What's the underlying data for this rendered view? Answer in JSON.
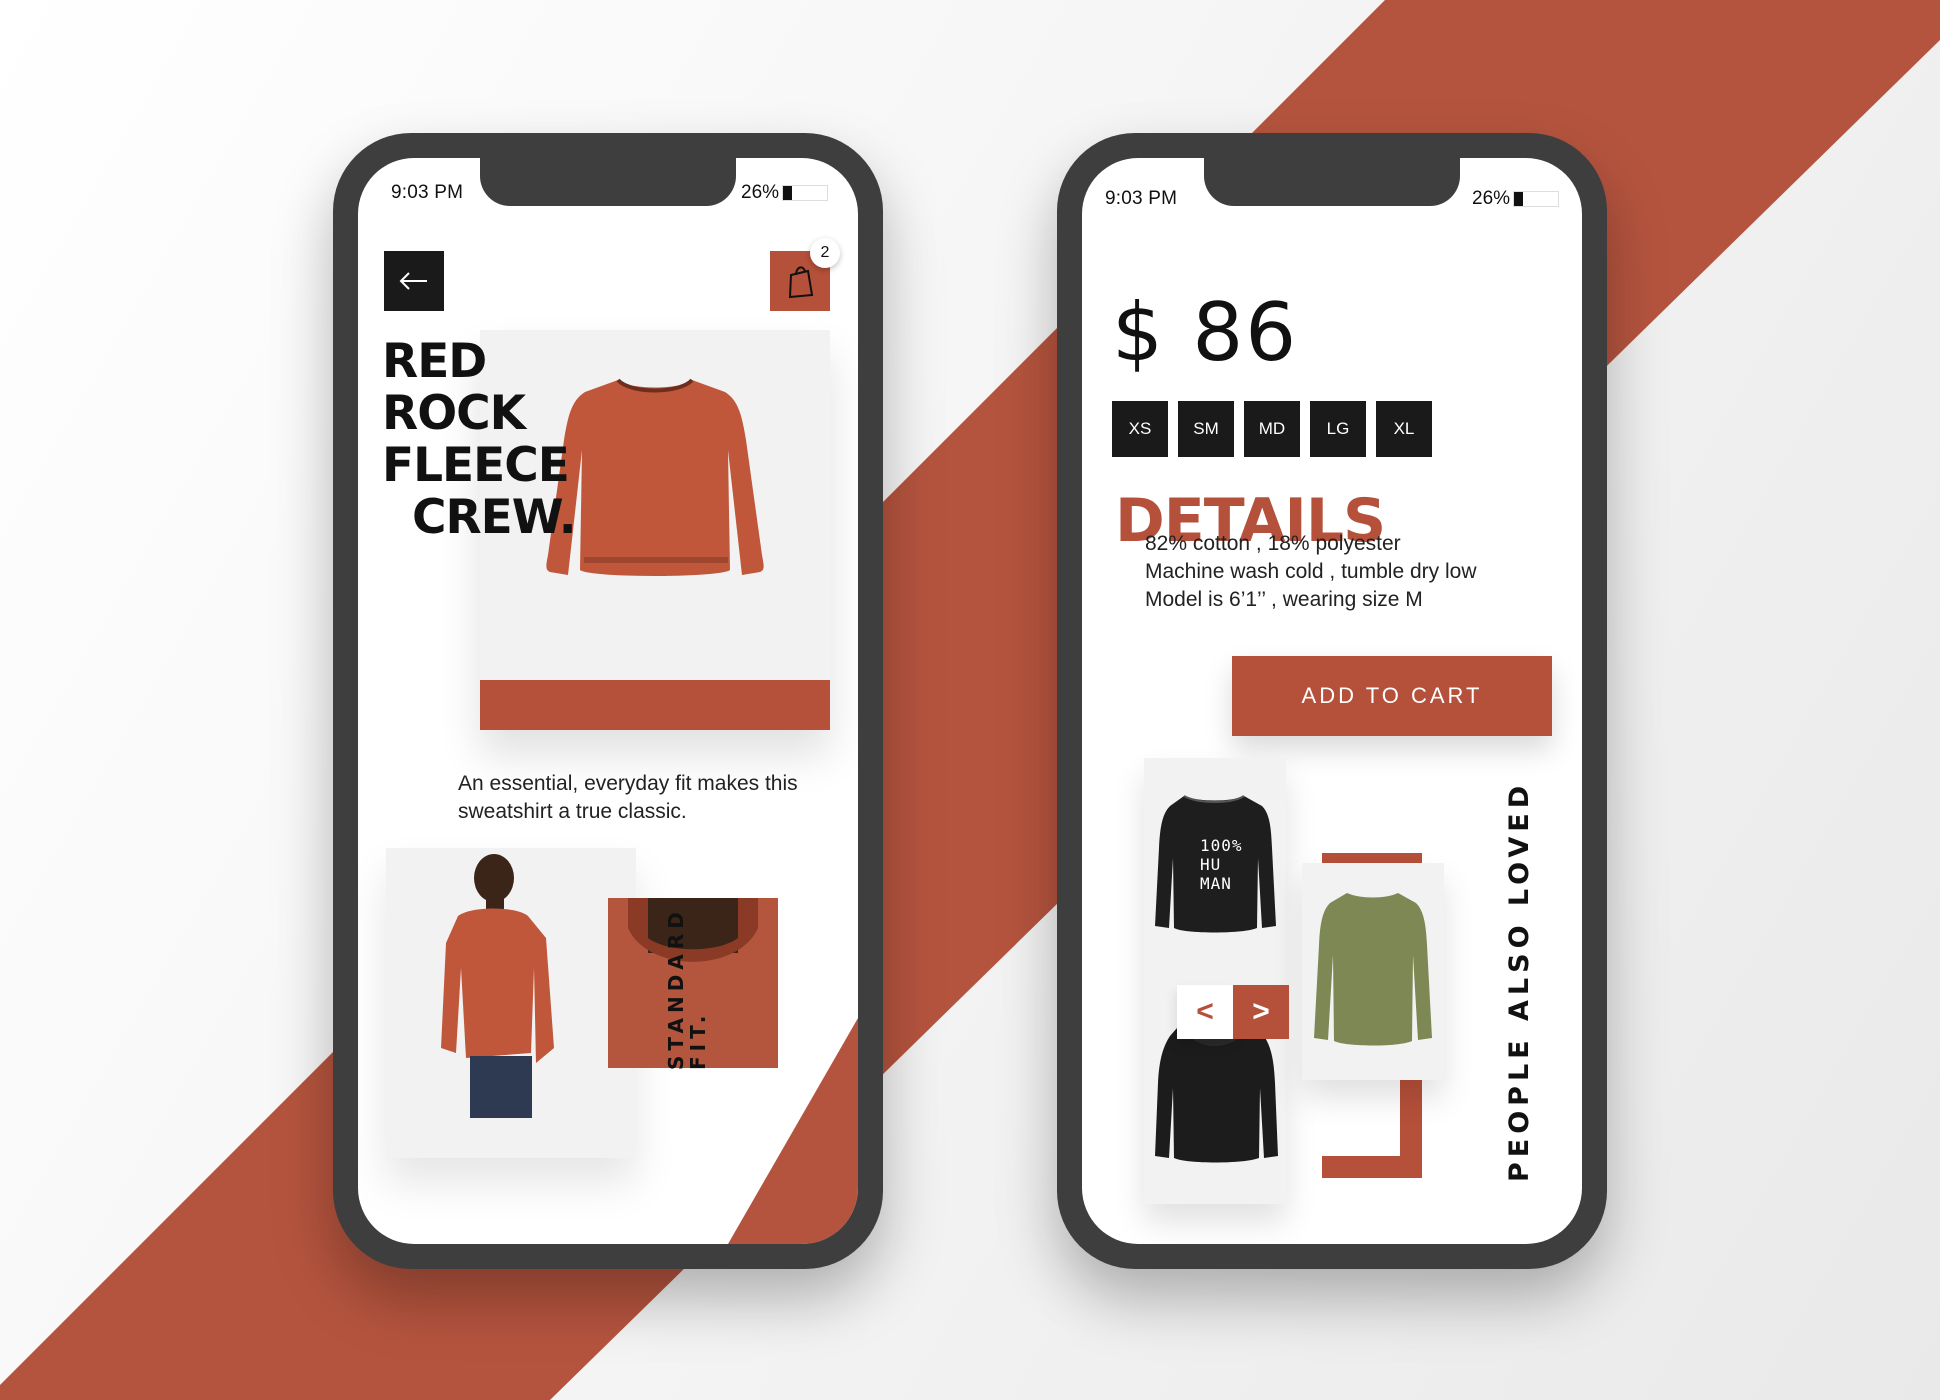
{
  "colors": {
    "accent": "#b5503a",
    "dark": "#1a1a1a",
    "phone_frame": "#3e3e3e",
    "olive": "#7d8855"
  },
  "left_screen": {
    "status_time": "9:03 PM",
    "battery": "26%",
    "back_icon": "arrow-left-icon",
    "cart_icon": "shopping-bag-icon",
    "cart_count": "2",
    "title_lines": [
      "RED",
      "ROCK",
      "FLEECE",
      "CREW."
    ],
    "description": "An essential, everyday fit makes this sweatshirt a true classic.",
    "fit_label": [
      "STANDARD",
      "FIT."
    ]
  },
  "right_screen": {
    "status_time": "9:03 PM",
    "battery": "26%",
    "price": "$ 86",
    "sizes": [
      "XS",
      "SM",
      "MD",
      "LG",
      "XL"
    ],
    "details_heading": "DETAILS",
    "details": [
      "82% cotton , 18% polyester",
      "Machine wash cold , tumble dry low",
      "Model is 6’1’’ , wearing size M"
    ],
    "add_to_cart": "ADD TO CART",
    "related_heading": "PEOPLE ALSO LOVED",
    "sweatshirt_print": [
      "100%",
      "HU",
      "MAN"
    ],
    "prev_label": "<",
    "next_label": ">"
  }
}
